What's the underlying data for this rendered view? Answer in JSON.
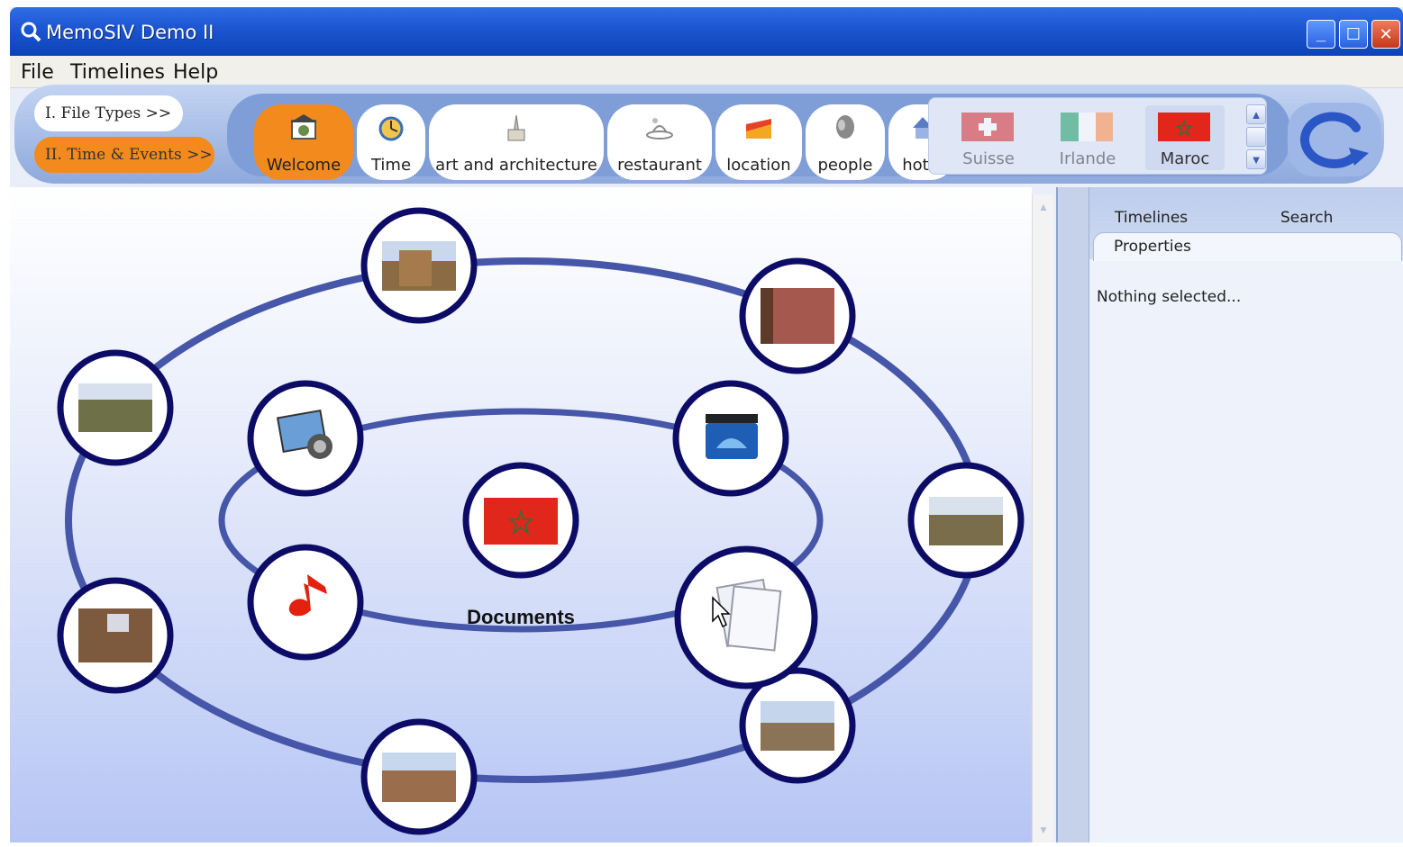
{
  "window": {
    "title": "MemoSIV Demo II"
  },
  "menu": {
    "items": [
      "File",
      "Timelines",
      "Help"
    ]
  },
  "mode_tabs": {
    "file_types": "I. File Types >>",
    "time_events": "II. Time & Events >>"
  },
  "categories": [
    {
      "label": "Welcome",
      "icon": "welcome-icon",
      "active": true
    },
    {
      "label": "Time",
      "icon": "time-icon",
      "active": false
    },
    {
      "label": "art and architecture",
      "icon": "architecture-icon",
      "active": false
    },
    {
      "label": "restaurant",
      "icon": "restaurant-icon",
      "active": false
    },
    {
      "label": "location",
      "icon": "location-icon",
      "active": false
    },
    {
      "label": "people",
      "icon": "people-icon",
      "active": false
    },
    {
      "label": "hotel",
      "icon": "hotel-icon",
      "active": false
    }
  ],
  "flags": [
    {
      "label": "Suisse",
      "color": "#d4282a",
      "faded": true
    },
    {
      "label": "Irlande",
      "colors": [
        "#169b62",
        "#ffffff",
        "#ff883e"
      ],
      "faded": true
    },
    {
      "label": "Maroc",
      "color": "#e1261c",
      "faded": false
    }
  ],
  "graph": {
    "center_label": "Documents",
    "inner_nodes": [
      "image-icon",
      "video-icon",
      "music-icon",
      "documents-icon"
    ],
    "outer_nodes": [
      "photo-kasbah",
      "photo-wall",
      "photo-palm-oasis",
      "photo-trees",
      "photo-market",
      "photo-desert-plain",
      "photo-desert-road"
    ]
  },
  "side_panel": {
    "tabs": [
      "Timelines",
      "Search",
      "Properties"
    ],
    "content": "Nothing selected..."
  },
  "colors": {
    "accent_orange": "#f28a1d",
    "titlebar_blue": "#1b55cf",
    "ring_navy": "#0c0c66",
    "orbit_blue": "#4656a8"
  }
}
